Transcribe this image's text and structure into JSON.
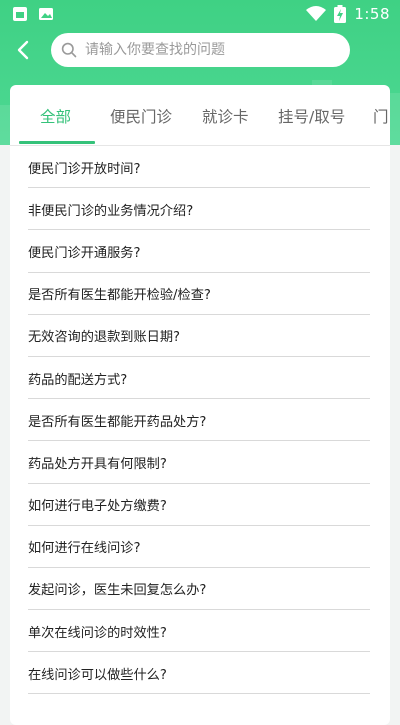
{
  "status_bar": {
    "time": "1:58"
  },
  "search": {
    "placeholder": "请输入你要查找的问题"
  },
  "tabs": [
    {
      "label": "全部",
      "active": true
    },
    {
      "label": "便民门诊",
      "active": false
    },
    {
      "label": "就诊卡",
      "active": false
    },
    {
      "label": "挂号/取号",
      "active": false
    },
    {
      "label": "门",
      "active": false
    }
  ],
  "questions": [
    "便民门诊开放时间?",
    "非便民门诊的业务情况介绍?",
    "便民门诊开通服务?",
    "是否所有医生都能开检验/检查?",
    "无效咨询的退款到账日期?",
    "药品的配送方式?",
    "是否所有医生都能开药品处方?",
    "药品处方开具有何限制?",
    "如何进行电子处方缴费?",
    "如何进行在线问诊?",
    "发起问诊，医生未回复怎么办?",
    "单次在线问诊的时效性?",
    "在线问诊可以做些什么?"
  ],
  "colors": {
    "header_green": "#3fd184",
    "accent": "#35c27a"
  }
}
